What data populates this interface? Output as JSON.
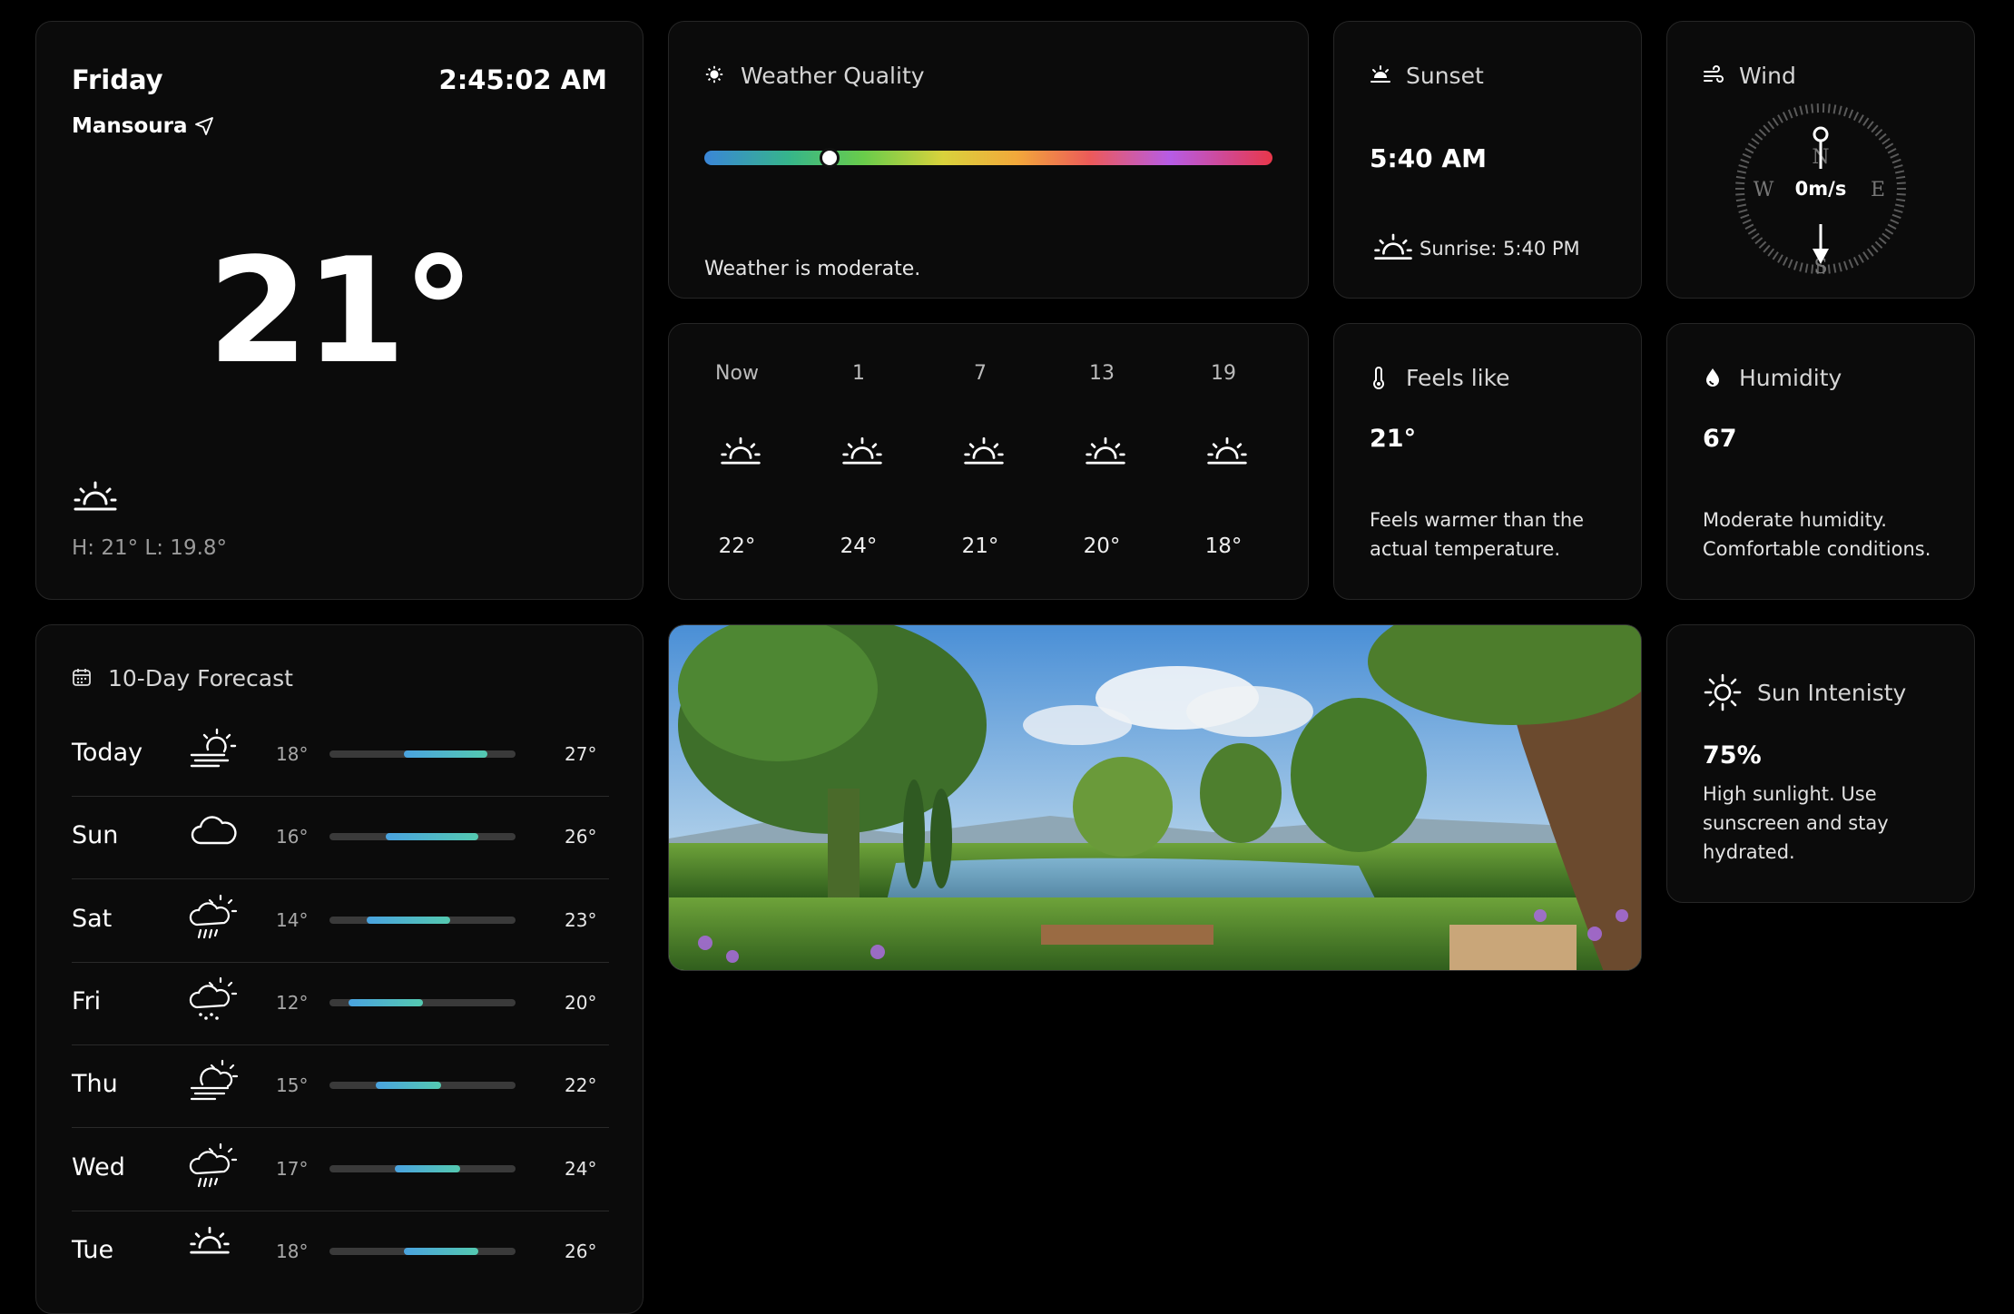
{
  "main": {
    "day": "Friday",
    "time": "2:45:02 AM",
    "city": "Mansoura",
    "temperature": "21°",
    "high_low": "H: 21°   L: 19.8°",
    "icon": "sunrise-icon"
  },
  "quality": {
    "title": "Weather Quality",
    "indicator_fraction": 0.22,
    "description": "Weather is moderate."
  },
  "sunset": {
    "title": "Sunset",
    "time": "5:40 AM",
    "sunrise": "Sunrise: 5:40 PM"
  },
  "wind": {
    "title": "Wind",
    "speed": "0m/s",
    "n": "N",
    "e": "E",
    "s": "S",
    "w": "W"
  },
  "hourly": [
    {
      "time": "Now",
      "temp": "22°",
      "icon": "sunrise-icon"
    },
    {
      "time": "1",
      "temp": "24°",
      "icon": "sunrise-icon"
    },
    {
      "time": "7",
      "temp": "21°",
      "icon": "sunrise-icon"
    },
    {
      "time": "13",
      "temp": "20°",
      "icon": "sunrise-icon"
    },
    {
      "time": "19",
      "temp": "18°",
      "icon": "sunrise-icon"
    }
  ],
  "feels_like": {
    "title": "Feels like",
    "value": "21°",
    "text": "Feels warmer than the actual temperature."
  },
  "humidity": {
    "title": "Humidity",
    "value": "67",
    "text": "Moderate humidity. Comfortable conditions."
  },
  "forecast": {
    "title": "10-Day Forecast",
    "range": [
      10,
      30
    ],
    "days": [
      {
        "day": "Today",
        "low": "18°",
        "high": "27°",
        "lo": 18,
        "hi": 27,
        "icon": "sun-wind-icon"
      },
      {
        "day": "Sun",
        "low": "16°",
        "high": "26°",
        "lo": 16,
        "hi": 26,
        "icon": "cloud-icon"
      },
      {
        "day": "Sat",
        "low": "14°",
        "high": "23°",
        "lo": 14,
        "hi": 23,
        "icon": "sun-rain-icon"
      },
      {
        "day": "Fri",
        "low": "12°",
        "high": "20°",
        "lo": 12,
        "hi": 20,
        "icon": "sun-drizzle-icon"
      },
      {
        "day": "Thu",
        "low": "15°",
        "high": "22°",
        "lo": 15,
        "hi": 22,
        "icon": "sun-cloud-wind-icon"
      },
      {
        "day": "Wed",
        "low": "17°",
        "high": "24°",
        "lo": 17,
        "hi": 24,
        "icon": "sun-rain-icon"
      },
      {
        "day": "Tue",
        "low": "18°",
        "high": "26°",
        "lo": 18,
        "hi": 26,
        "icon": "sunrise-icon"
      }
    ]
  },
  "sun_intensity": {
    "title": "Sun Intenisty",
    "value": "75%",
    "text": "High sunlight. Use sunscreen and stay hydrated."
  },
  "colors": {
    "background": "#000000",
    "card": "#0b0b0b",
    "bar_start": "#4aa3e0",
    "bar_end": "#54c9b0"
  }
}
